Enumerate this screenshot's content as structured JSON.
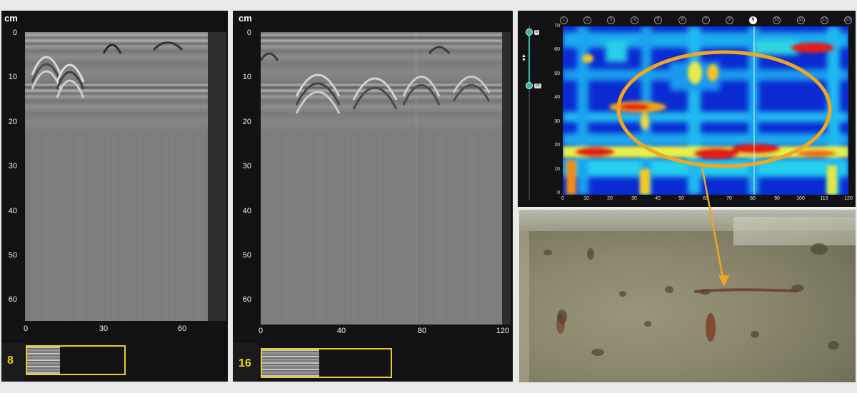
{
  "left_scan": {
    "unit": "cm",
    "y_ticks": [
      "0",
      "10",
      "20",
      "30",
      "40",
      "50",
      "60"
    ],
    "x_ticks": [
      "0",
      "30",
      "60"
    ],
    "thumbnail_number": "8"
  },
  "middle_scan": {
    "unit": "cm",
    "y_ticks": [
      "0",
      "10",
      "20",
      "30",
      "40",
      "50",
      "60"
    ],
    "x_ticks": [
      "0",
      "40",
      "80",
      "120"
    ],
    "thumbnail_number": "16"
  },
  "heatmap": {
    "channels": [
      "1",
      "2",
      "3",
      "4",
      "5",
      "6",
      "7",
      "8",
      "9",
      "10",
      "11",
      "12",
      "13"
    ],
    "active_channel": "9",
    "y_ticks": [
      "70",
      "60",
      "50",
      "40",
      "30",
      "20",
      "10",
      "0"
    ],
    "x_ticks": [
      "0",
      "10",
      "20",
      "30",
      "40",
      "50",
      "60",
      "70",
      "80",
      "90",
      "100",
      "110",
      "120"
    ],
    "slider": {
      "top_value": "5",
      "bottom_value": "26"
    },
    "colors": {
      "low": "#0a2bd1",
      "mid": "#22d6ef",
      "high": "#e41b12",
      "annotation": "#f2a61f"
    }
  },
  "photo": {}
}
